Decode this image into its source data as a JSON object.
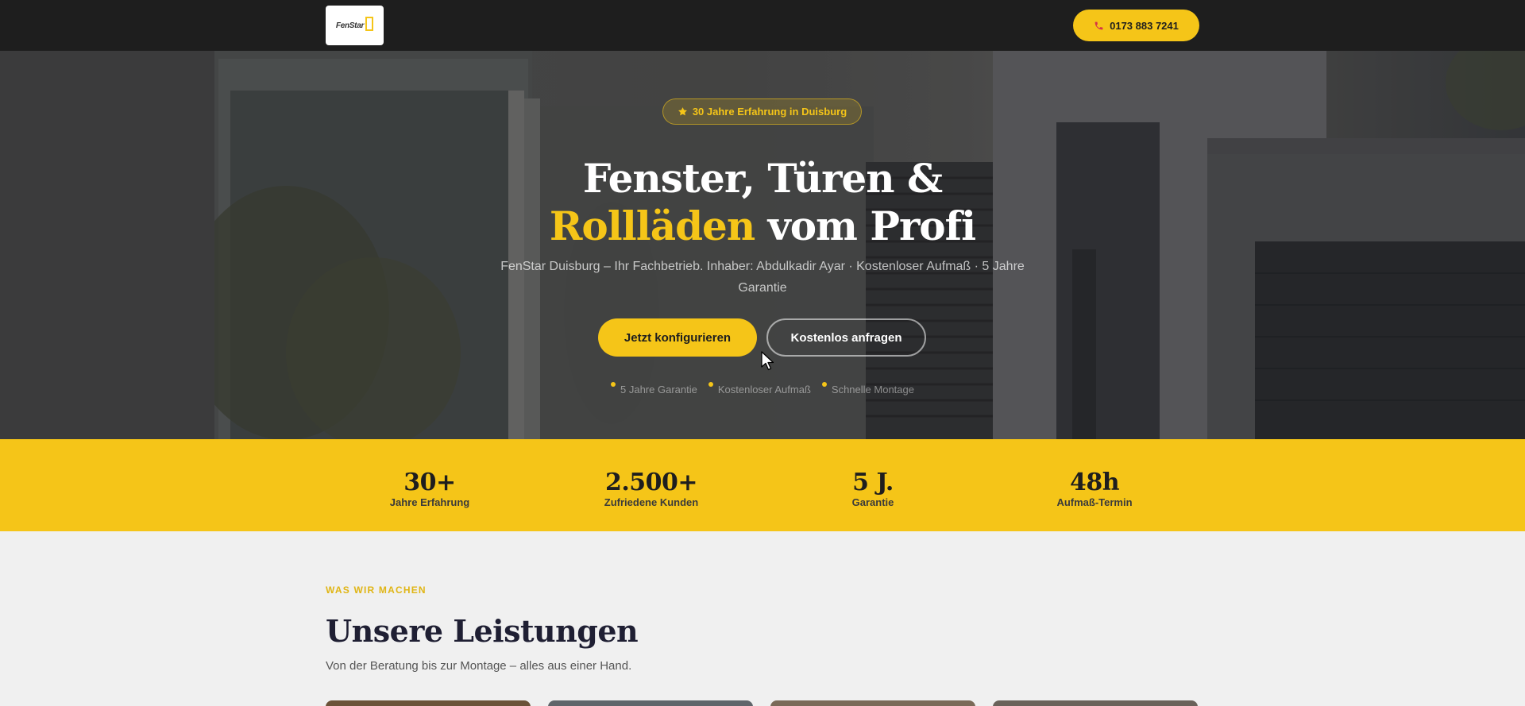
{
  "header": {
    "logo_text": "FenStar",
    "phone_label": "0173 883 7241",
    "phone_icon": "phone-icon"
  },
  "hero": {
    "badge": "30 Jahre Erfahrung in Duisburg",
    "badge_icon": "star-icon",
    "title_part1": "Fenster, Türen &",
    "title_accent": "Rollläden",
    "title_part2": "vom Profi",
    "subtitle": "FenStar Duisburg – Ihr Fachbetrieb. Inhaber: Abdulkadir Ayar · Kostenloser Aufmaß · 5 Jahre Garantie",
    "cta_primary": "Jetzt konfigurieren",
    "cta_secondary": "Kostenlos anfragen",
    "features": [
      "5 Jahre Garantie",
      "Kostenloser Aufmaß",
      "Schnelle Montage"
    ]
  },
  "stats": [
    {
      "value": "30+",
      "label": "Jahre Erfahrung"
    },
    {
      "value": "2.500+",
      "label": "Zufriedene Kunden"
    },
    {
      "value": "5 J.",
      "label": "Garantie"
    },
    {
      "value": "48h",
      "label": "Aufmaß-Termin"
    }
  ],
  "services": {
    "eyebrow": "WAS WIR MACHEN",
    "title": "Unsere Leistungen",
    "subtitle": "Von der Beratung bis zur Montage – alles aus einer Hand."
  },
  "colors": {
    "accent": "#f5c518",
    "dark": "#1e1e1e",
    "heading": "#1f1f33"
  }
}
